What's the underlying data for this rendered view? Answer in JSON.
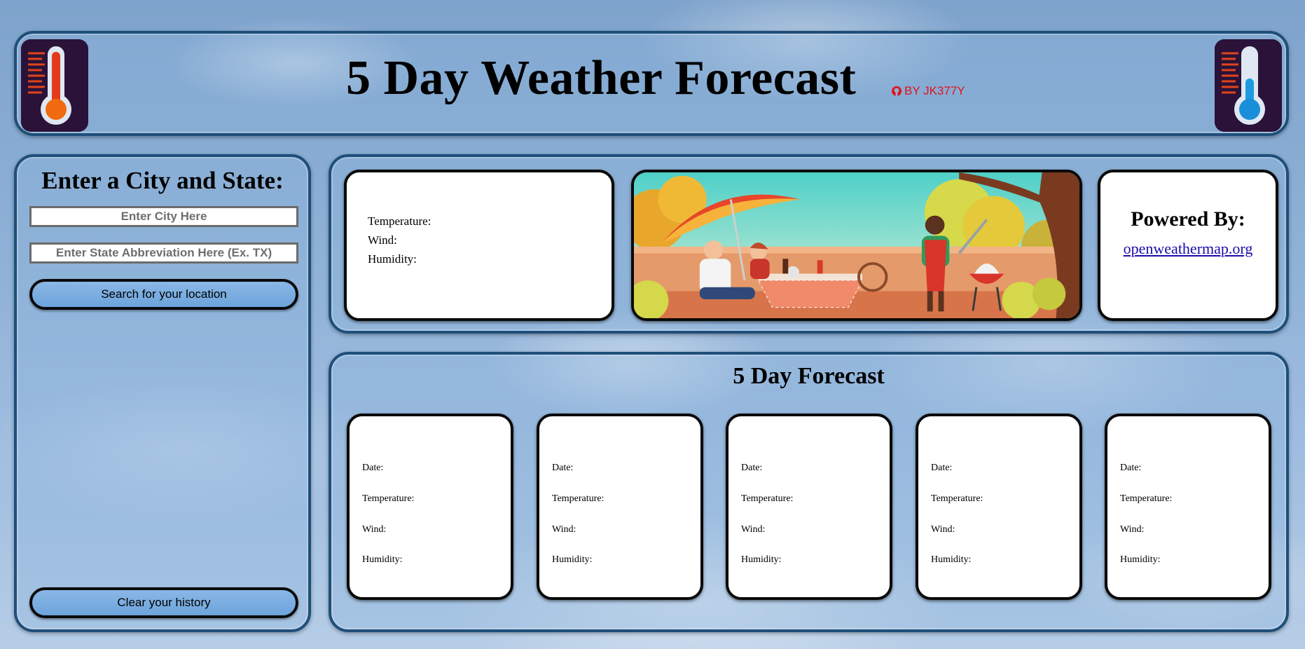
{
  "header": {
    "title": "5 Day Weather Forecast",
    "byline": "BY JK377Y",
    "left_icon": "hot-thermometer-icon",
    "right_icon": "cold-thermometer-icon"
  },
  "sidebar": {
    "title": "Enter a City and State:",
    "city_placeholder": "Enter City Here",
    "state_placeholder": "Enter State Abbreviation Here (Ex. TX)",
    "search_label": "Search for your location",
    "clear_label": "Clear your history"
  },
  "current": {
    "temperature_label": "Temperature:",
    "wind_label": "Wind:",
    "humidity_label": "Humidity:",
    "banner_image": "barbecue-picnic-illustration"
  },
  "powered": {
    "title": "Powered By:",
    "link": "openweathermap.org"
  },
  "forecast": {
    "title": "5 Day Forecast",
    "days": [
      {
        "date": "Date:",
        "temperature": "Temperature:",
        "wind": "Wind:",
        "humidity": "Humidity:"
      },
      {
        "date": "Date:",
        "temperature": "Temperature:",
        "wind": "Wind:",
        "humidity": "Humidity:"
      },
      {
        "date": "Date:",
        "temperature": "Temperature:",
        "wind": "Wind:",
        "humidity": "Humidity:"
      },
      {
        "date": "Date:",
        "temperature": "Temperature:",
        "wind": "Wind:",
        "humidity": "Humidity:"
      },
      {
        "date": "Date:",
        "temperature": "Temperature:",
        "wind": "Wind:",
        "humidity": "Humidity:"
      }
    ]
  },
  "colors": {
    "panel_border": "#1f4f7a",
    "button_fill": "#7aaee0",
    "byline": "#e0141c",
    "link": "#1a0dab"
  }
}
